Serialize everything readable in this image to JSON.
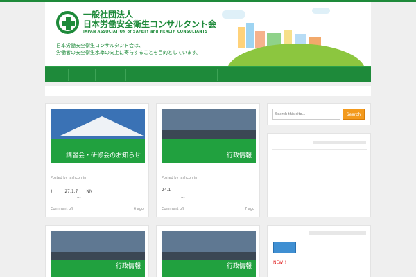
{
  "header": {
    "org_name_line1": "一般社団法人",
    "org_name_line2": "日本労働安全衛生コンサルタント会",
    "org_name_en": "JAPAN ASSOCIATION of SAFETY and HEALTH CONSULTANTS",
    "tagline_line1": "日本労働安全衛生コンサルタント会は、",
    "tagline_line2": "労働者の安全衛生水準の向上に寄与することを目的としています。",
    "brand_color": "#1e8a3a"
  },
  "posts": [
    {
      "image": "mount-fuji",
      "image_label": "講習会・研修会のお知らせ",
      "meta": "Posted by jashcon in",
      "excerpt_line1": ")　　　27.1.7　　NN",
      "excerpt_line2": "...",
      "comments": "Comment off",
      "age": "6 ago"
    },
    {
      "image": "city-skyline",
      "image_label": "行政情報",
      "meta": "Posted by jashcon in",
      "excerpt_line1": "24.1",
      "excerpt_line2": "...",
      "comments": "Comment off",
      "age": "7 ago"
    },
    {
      "image": "city-skyline",
      "image_label": "行政情報"
    },
    {
      "image": "city-skyline",
      "image_label": "行政情報"
    }
  ],
  "sidebar": {
    "search_placeholder": "Search this site...",
    "search_button": "Search",
    "new_label": "NEW!!"
  },
  "colors": {
    "nav_green": "#1e8a3a",
    "search_button": "#f39a1d",
    "thumb_green": "#21a13f",
    "new_red": "#e02020"
  }
}
